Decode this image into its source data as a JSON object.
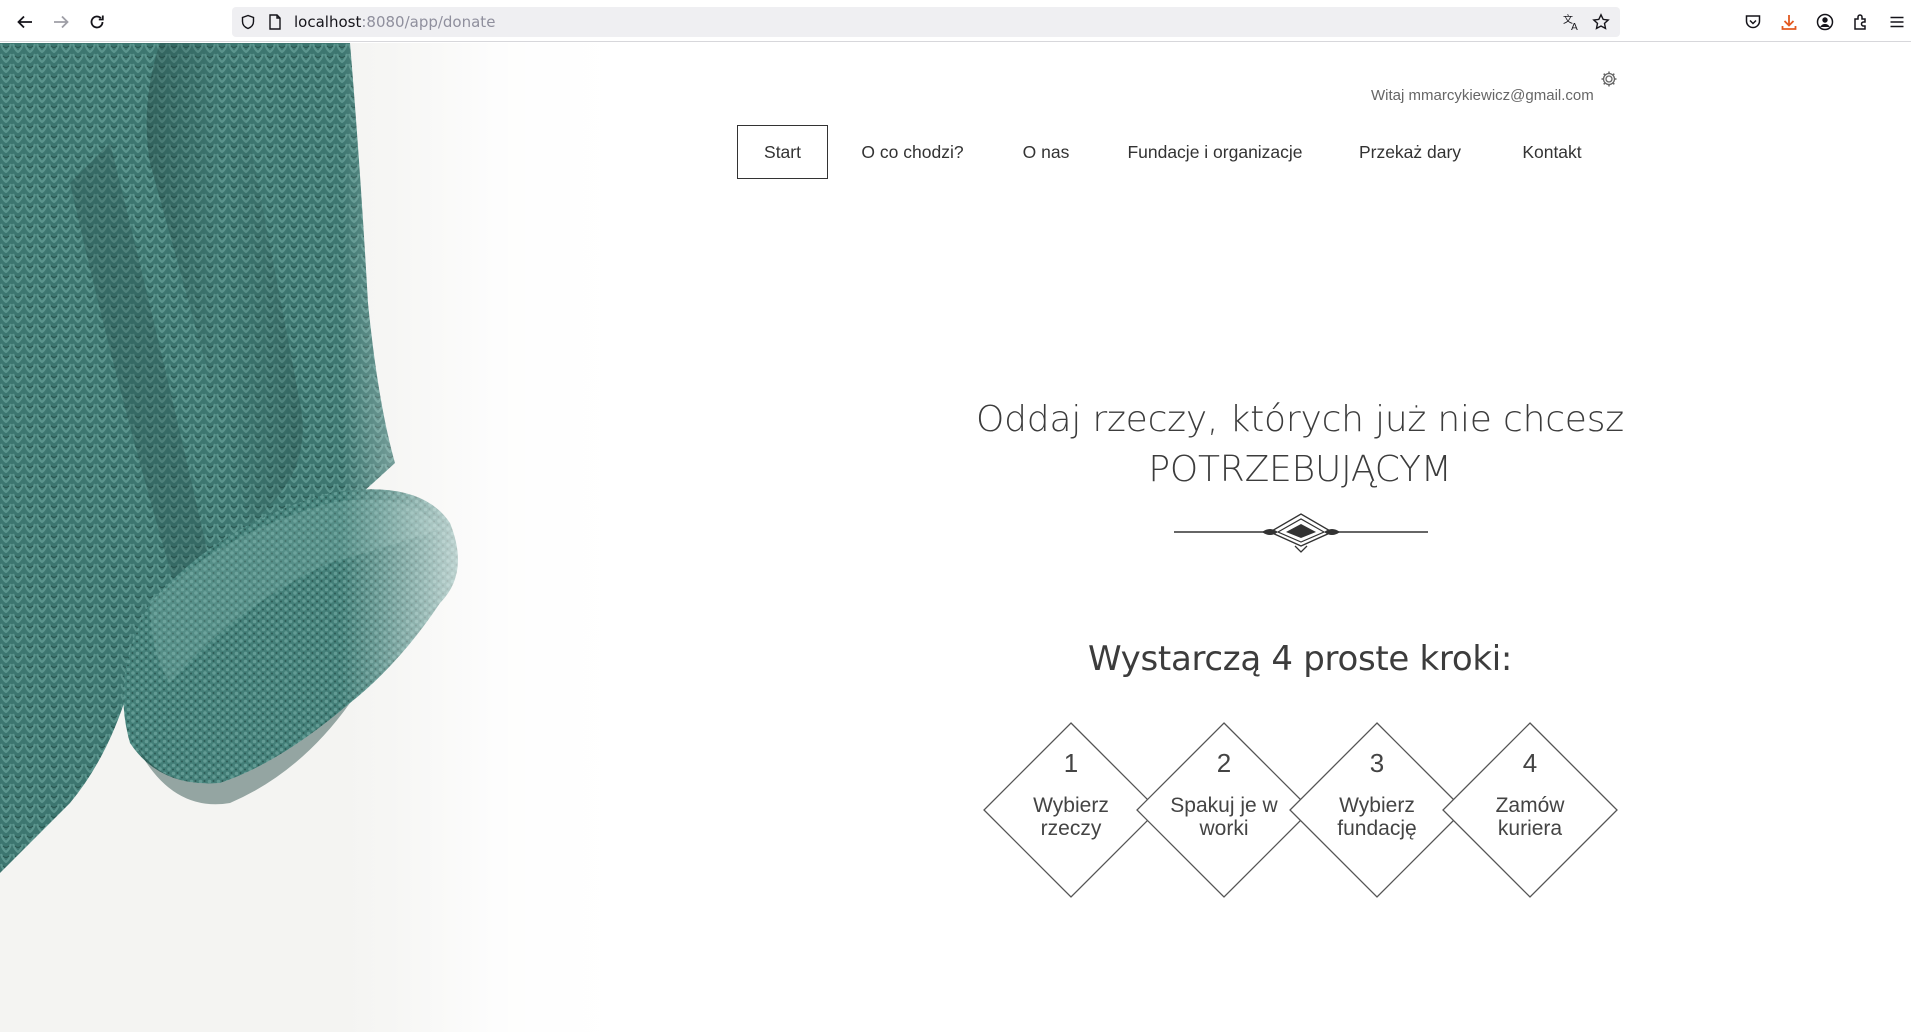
{
  "browser": {
    "url_host": "localhost",
    "url_rest": ":8080/app/donate",
    "icons": [
      "back-arrow-icon",
      "forward-arrow-icon",
      "reload-icon",
      "shield-icon",
      "page-icon",
      "translate-icon",
      "bookmark-star-icon",
      "pocket-icon",
      "download-icon",
      "account-icon",
      "extensions-icon",
      "menu-icon"
    ]
  },
  "header": {
    "welcome": "Witaj mmarcykiewicz@gmail.com",
    "nav": [
      {
        "label": "Start",
        "active": true
      },
      {
        "label": "O co chodzi?"
      },
      {
        "label": "O nas"
      },
      {
        "label": "Fundacje i organizacje"
      },
      {
        "label": "Przekaż dary"
      },
      {
        "label": "Kontakt"
      }
    ]
  },
  "hero": {
    "headline_line1": "Oddaj rzeczy, których już nie chcesz",
    "headline_line2": "POTRZEBUJĄCYM",
    "subheading": "Wystarczą 4 proste kroki:",
    "steps": [
      {
        "number": "1",
        "label": "Wybierz rzeczy"
      },
      {
        "number": "2",
        "label": "Spakuj je w worki"
      },
      {
        "number": "3",
        "label": "Wybierz fundację"
      },
      {
        "number": "4",
        "label": "Zamów kuriera"
      }
    ]
  },
  "colors": {
    "sweater": "#3f7a73",
    "text": "#333333",
    "download_accent": "#e25920"
  }
}
